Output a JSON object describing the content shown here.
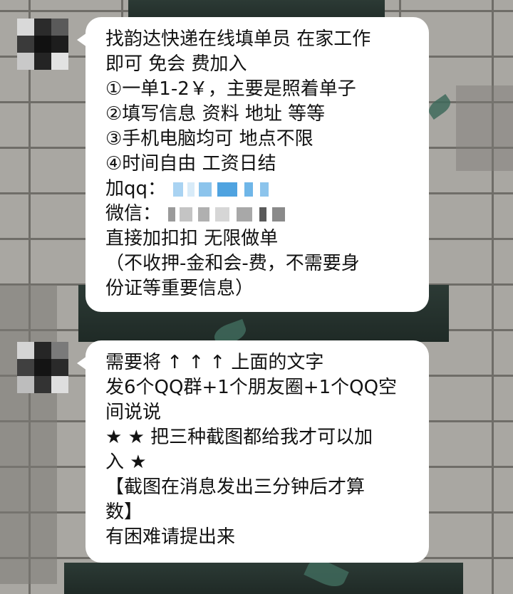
{
  "messages": [
    {
      "lines": [
        "找韵达快递在线填单员 在家工作",
        "即可 免会 费加入",
        "①一单1-2￥，主要是照着单子",
        "②填写信息 资料 地址 等等",
        "③手机电脑均可 地点不限",
        "④时间自由  工资日结"
      ],
      "qq_label": "加qq：",
      "wechat_label": "微信：",
      "closing_lines": [
        " 直接加扣扣 无限做单",
        " （不收押-金和会-费，不需要身",
        "份证等重要信息）"
      ]
    },
    {
      "lines": [
        "需要将 ↑ ↑  ↑ 上面的文字",
        "发6个QQ群+1个朋友圈+1个QQ空",
        "间说说",
        "★ ★ 把三种截图都给我才可以加",
        "入 ★",
        "【截图在消息发出三分钟后才算",
        "数】",
        "有困难请提出来"
      ]
    }
  ],
  "colors": {
    "bubble": "#ffffff",
    "text": "#121212",
    "redact_blue": "#6fb6e8",
    "redact_gray": "#9a9a9a"
  },
  "icons": {
    "avatar": "pixelated-avatar"
  }
}
